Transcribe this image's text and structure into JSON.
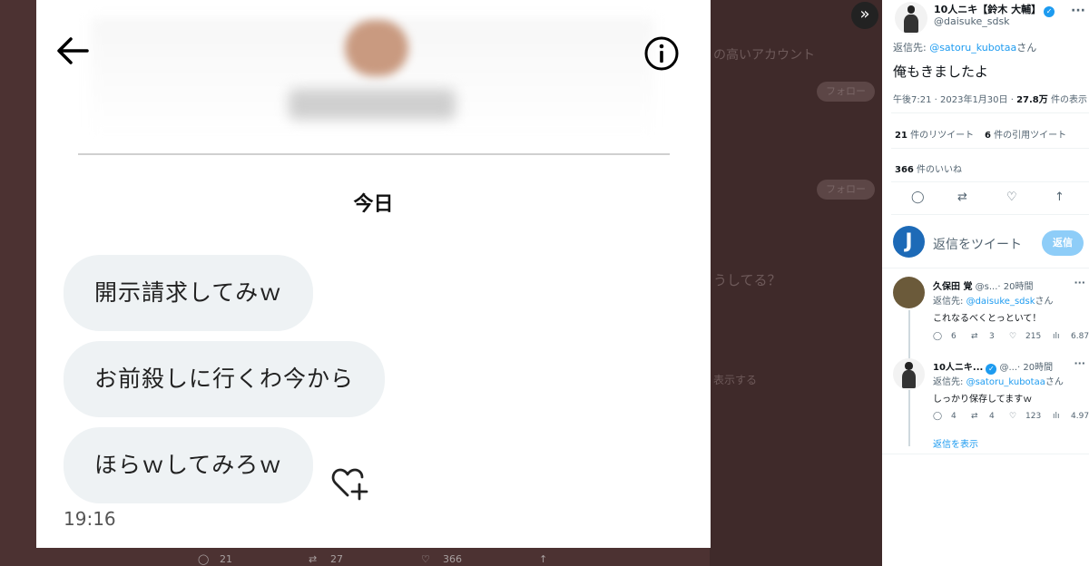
{
  "dm": {
    "date_label": "今日",
    "messages": [
      "開示請求してみｗ",
      "お前殺しに行くわ今から",
      "ほらｗしてみろｗ"
    ],
    "time": "19:16"
  },
  "background": {
    "section_title": "の高いアカウント",
    "follow_label": "フォロー",
    "whats_happening": "うしてる？",
    "show_more": "表示する",
    "bottom_counts": [
      "21",
      "27",
      "366"
    ]
  },
  "tweet": {
    "author_name": "10人ニキ【鈴木 大輔】",
    "author_handle": "@daisuke_sdsk",
    "reply_prefix": "返信先: ",
    "reply_to": "@satoru_kubotaa",
    "reply_suffix": "さん",
    "text": "俺もきましたよ",
    "meta": "午後7:21 · 2023年1月30日 · ",
    "views_count": "27.8万",
    "views_suffix": " 件の表示",
    "retweets_count": "21",
    "retweets_label": " 件のリツイート",
    "quotes_count": "6",
    "quotes_label": " 件の引用ツイート",
    "likes_count": "366",
    "likes_label": " 件のいいね"
  },
  "composer": {
    "avatar_letter": "J",
    "placeholder": "返信をツイート",
    "button": "返信"
  },
  "replies": [
    {
      "name": "久保田 覚",
      "handle": "@s...",
      "time": "· 20時間",
      "reply_to": "@daisuke_sdsk",
      "text": "これなるべくとっといて！",
      "replies": "6",
      "retweets": "3",
      "likes": "215",
      "views": "6.87"
    },
    {
      "name": "10人ニキ...",
      "handle": "@...",
      "time": "· 20時間",
      "reply_to": "@satoru_kubotaa",
      "text": "しっかり保存してますｗ",
      "replies": "4",
      "retweets": "4",
      "likes": "123",
      "views": "4.97"
    }
  ],
  "show_replies": "返信を表示",
  "colors": {
    "accent": "#1d9bf0",
    "bubble": "#eef2f4",
    "backdrop": "#4c3232"
  }
}
